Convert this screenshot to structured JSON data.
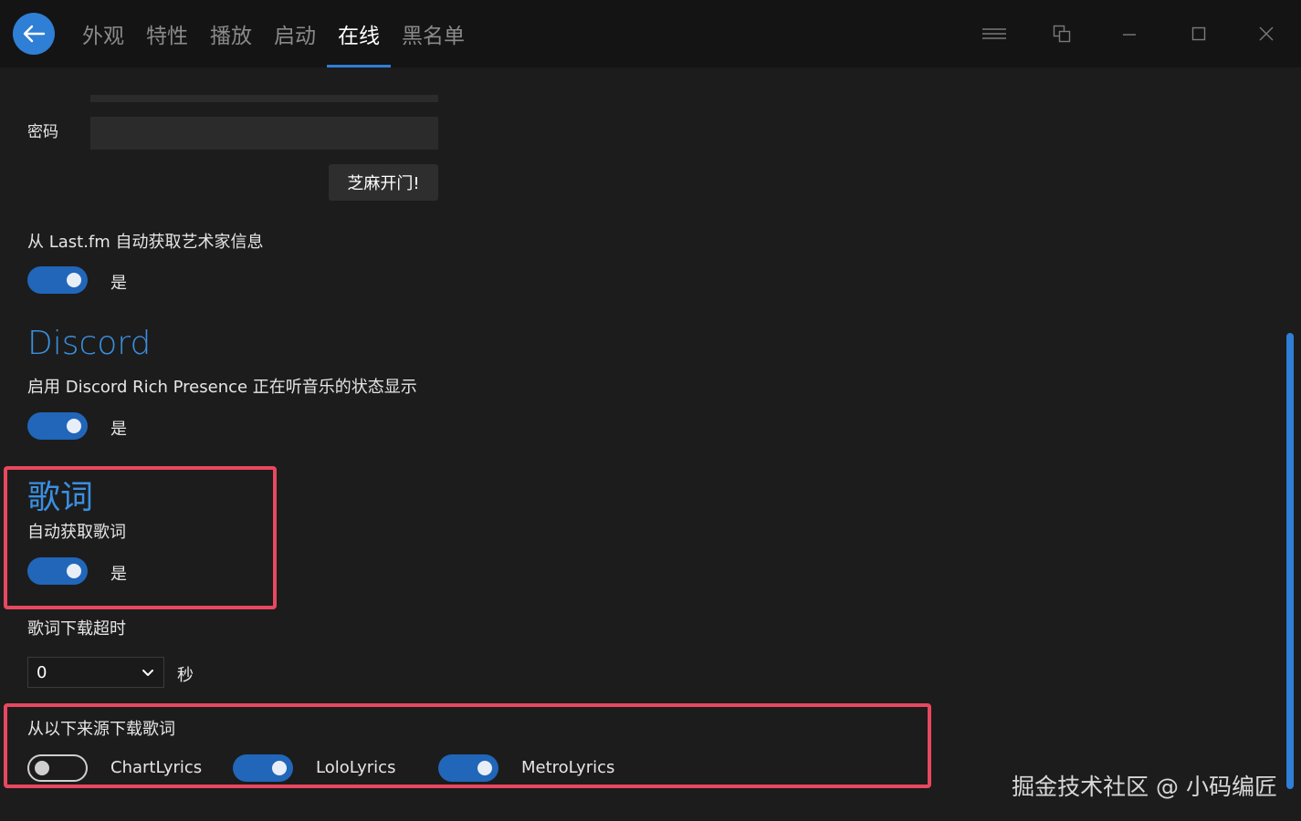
{
  "nav": {
    "tabs": [
      {
        "label": "外观",
        "active": false
      },
      {
        "label": "特性",
        "active": false
      },
      {
        "label": "播放",
        "active": false
      },
      {
        "label": "启动",
        "active": false
      },
      {
        "label": "在线",
        "active": true
      },
      {
        "label": "黑名单",
        "active": false
      }
    ]
  },
  "lastfm": {
    "password_label": "密码",
    "password_value": "",
    "login_button": "芝麻开门!",
    "artist_info_label": "从 Last.fm 自动获取艺术家信息",
    "artist_info_toggle": {
      "on": true,
      "label": "是"
    }
  },
  "discord": {
    "title": "Discord",
    "rich_presence_label": "启用 Discord Rich Presence 正在听音乐的状态显示",
    "rich_presence_toggle": {
      "on": true,
      "label": "是"
    }
  },
  "lyrics": {
    "title": "歌词",
    "auto_fetch_label": "自动获取歌词",
    "auto_fetch_toggle": {
      "on": true,
      "label": "是"
    },
    "timeout_label": "歌词下载超时",
    "timeout_value": "0",
    "timeout_unit": "秒",
    "sources_label": "从以下来源下载歌词",
    "sources": [
      {
        "name": "ChartLyrics",
        "on": false
      },
      {
        "name": "LoloLyrics",
        "on": true
      },
      {
        "name": "MetroLyrics",
        "on": true
      }
    ]
  },
  "watermark": "掘金技术社区 @ 小码编匠",
  "colors": {
    "accent": "#2f7fd6",
    "toggle_on": "#2166b9",
    "highlight": "#e8485f",
    "background": "#1c1c1c",
    "titlebar": "#141414"
  }
}
